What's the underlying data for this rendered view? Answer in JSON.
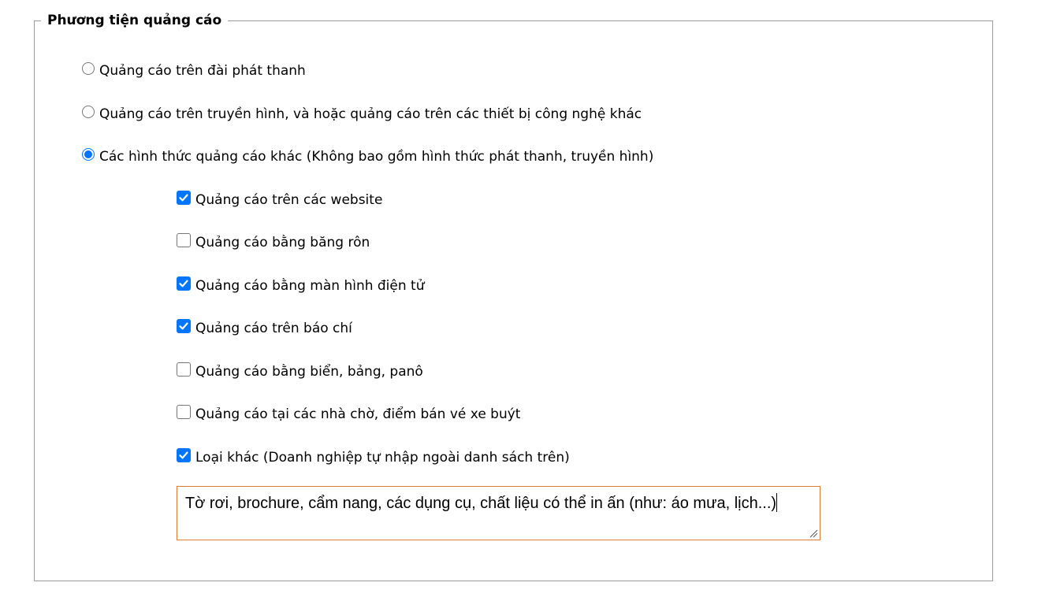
{
  "fieldset": {
    "legend": "Phương tiện quảng cáo"
  },
  "radios": [
    {
      "label": "Quảng cáo trên đài phát thanh",
      "checked": false
    },
    {
      "label": "Quảng cáo trên truyền hình, và hoặc quảng cáo trên các thiết bị công nghệ khác",
      "checked": false
    },
    {
      "label": "Các hình thức quảng cáo khác (Không bao gồm hình thức phát thanh, truyền hình)",
      "checked": true
    }
  ],
  "checkboxes": [
    {
      "label": "Quảng cáo trên các website",
      "checked": true
    },
    {
      "label": "Quảng cáo bằng băng rôn",
      "checked": false
    },
    {
      "label": "Quảng cáo bằng màn hình điện tử",
      "checked": true
    },
    {
      "label": "Quảng cáo trên báo chí",
      "checked": true
    },
    {
      "label": "Quảng cáo bằng biển, bảng, panô",
      "checked": false
    },
    {
      "label": "Quảng cáo tại các nhà chờ, điểm bán vé xe buýt",
      "checked": false
    },
    {
      "label": "Loại khác (Doanh nghiệp tự nhập ngoài danh sách trên)",
      "checked": true
    }
  ],
  "other_input": {
    "value": "Tờ rơi, brochure, cẩm nang, các dụng cụ, chất liệu có thể in ấn (như: áo mưa, lịch...)"
  },
  "colors": {
    "accent": "#0075ff",
    "textarea_border": "#e07c2e",
    "fieldset_border": "#9a9a9a"
  }
}
